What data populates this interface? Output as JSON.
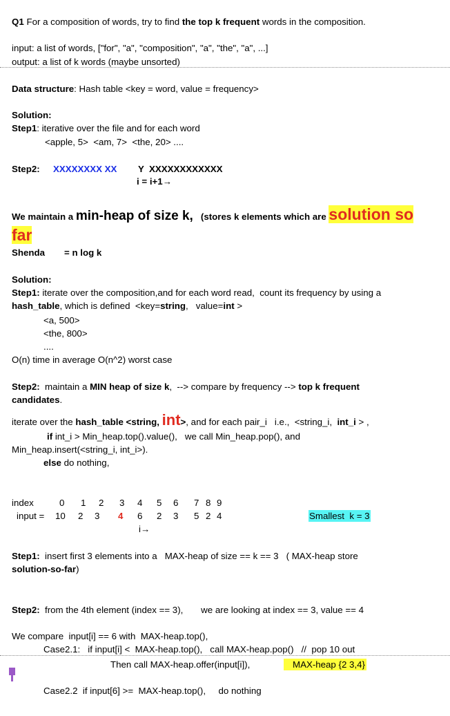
{
  "q1": {
    "prefix": "Q1",
    "text_a": " For a composition of words, try to find ",
    "bold": "the top k frequent",
    "text_b": " words in the composition."
  },
  "input_line": "input: a list of words, [\"for\", \"a\", \"composition\", \"a\", \"the\", \"a\", ...]",
  "output_line": "output: a list of k words (maybe unsorted)",
  "data_structure": {
    "label": "Data structure",
    "text": ": Hash table <key = word, value = frequency>"
  },
  "solution1": {
    "label": "Solution:",
    "step1_label": "Step1",
    "step1_text": ": iterative over the file and for each word",
    "step1_example": "<apple, 5>  <am, 7>  <the, 20> ....",
    "step2_label": "Step2:",
    "step2_blue": "XXXXXXXX XX",
    "step2_rest": "Y  XXXXXXXXXXXX",
    "step2_incr": "i = i+1→"
  },
  "minheap": {
    "text_a": "We maintain a ",
    "big": "min-heap of size k,",
    "text_b": "   (stores k elements which are ",
    "highlight_1": "solution so",
    "highlight_2": "far"
  },
  "shenda": {
    "label": "Shenda",
    "value": "= n log k"
  },
  "solution2": {
    "label": "Solution:",
    "step1_label": "Step1:",
    "step1_text": " iterate over the composition,and for each word read,  count its frequency by using a",
    "hash_table": "hash_table",
    "defined": ", which is defined  <key=",
    "string": "string",
    "value_eq": ",   value=",
    "int": "int",
    "close": " >",
    "ex1": "<a, 500>",
    "ex2": "<the, 800>",
    "ellipsis": "....",
    "complexity": "O(n) time in average O(n^2) worst case"
  },
  "step2b": {
    "label": "Step2:",
    "text_a": "  maintain a ",
    "min_heap": "MIN heap of size k",
    "text_b": ",  --> compare by frequency --> ",
    "top_k": "top k frequent",
    "candidates": "candidates",
    "period": "."
  },
  "iterate": {
    "text_a": "iterate over the ",
    "hash_table": "hash_table <string, ",
    "int_big": "int",
    "gt": ">",
    "text_b": ", and for each pair_i   i.e.,  <string_i,  ",
    "int_i": "int_i",
    "text_c": " > ,",
    "if_kw": "if",
    "if_text": " int_i > Min_heap.top().value(),   we call Min_heap.pop(), and",
    "insert": "Min_heap.insert(<string_i, int_i>).",
    "else_kw": "else",
    "else_text": " do nothing,"
  },
  "array": {
    "index_label": "index",
    "input_label": "input =",
    "indices": [
      "0",
      "1",
      "2",
      "3",
      "4",
      "5",
      "6",
      "7",
      "8",
      "9"
    ],
    "values": [
      "10",
      "2",
      "3",
      "4",
      "6",
      "2",
      "3",
      "5",
      "2",
      "4"
    ],
    "pointer": "i→",
    "smallest": "Smallest  k = 3"
  },
  "step1c": {
    "label": "Step1:",
    "text": "  insert first 3 elements into a   MAX-heap of size == k == 3   ( MAX-heap store",
    "bold2": "solution-so-far",
    "close": ")"
  },
  "step2c": {
    "label": "Step2:",
    "text": "  from the 4th element (index == 3),       we are looking at index == 3, value == 4"
  },
  "compare": {
    "line1": "We compare  input[i] == 6 with  MAX-heap.top(),",
    "line2": "Case2.1:   if input[i] <  MAX-heap.top(),   call MAX-heap.pop()   //  pop 10 out",
    "line3": "Then call MAX-heap.offer(input[i]),",
    "line3_hl": "MAX-heap {2 3,4}",
    "line4": "Case2.2  if input[6] >=  MAX-heap.top(),     do nothing"
  }
}
